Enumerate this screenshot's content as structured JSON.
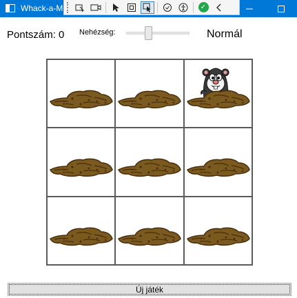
{
  "window": {
    "title": "Whack-a-Mole"
  },
  "debug_toolbar": {
    "icons": [
      "grip-icon",
      "select-element-icon",
      "record-icon",
      "pointer-icon",
      "adorner-icon",
      "track-focus-icon",
      "binding-failures-icon",
      "accessibility-icon",
      "check-icon",
      "collapse-icon"
    ]
  },
  "header": {
    "score_label": "Pontszám:",
    "score_value": "0",
    "difficulty_label": "Nehézség:",
    "difficulty_level": 0.33,
    "difficulty_value": "Normál"
  },
  "grid": {
    "rows": 3,
    "cols": 3,
    "mole_cell_index": 2
  },
  "actions": {
    "new_game_label": "Új játék"
  },
  "colors": {
    "titlebar": "#0078d7",
    "mound_dark": "#4a2d0c",
    "mound_light": "#7a5a1e",
    "grid_line": "#5a5a5a"
  }
}
